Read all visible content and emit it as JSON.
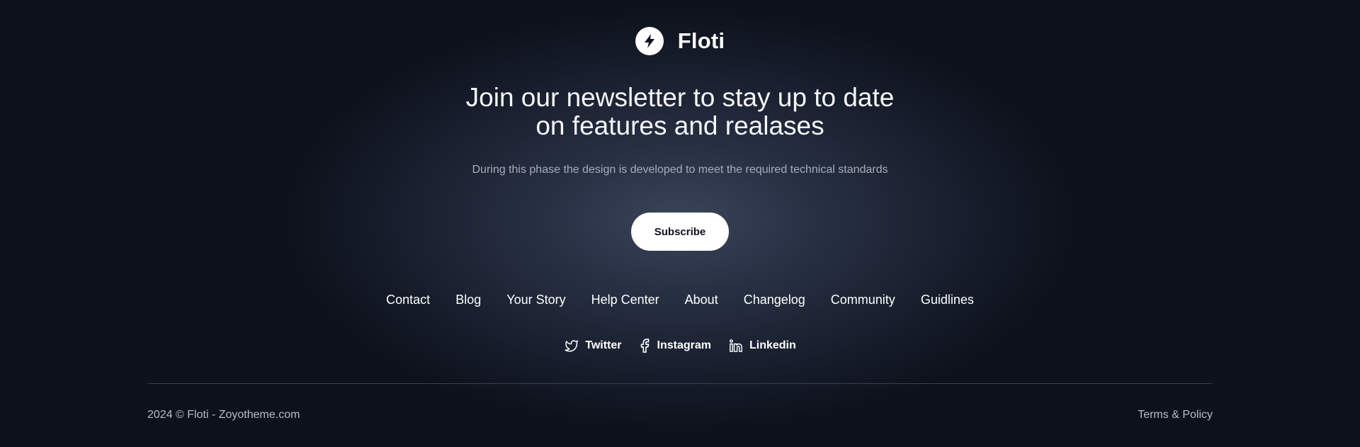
{
  "brand": {
    "name": "Floti",
    "logo_icon": "lightning-bolt-icon"
  },
  "newsletter": {
    "headline_line1": "Join our newsletter to stay up to date",
    "headline_line2": "on features and realases",
    "description": "During this phase the design is developed to meet the required technical standards",
    "subscribe_label": "Subscribe"
  },
  "nav": {
    "links": [
      {
        "label": "Contact"
      },
      {
        "label": "Blog"
      },
      {
        "label": "Your Story"
      },
      {
        "label": "Help Center"
      },
      {
        "label": "About"
      },
      {
        "label": "Changelog"
      },
      {
        "label": "Community"
      },
      {
        "label": "Guidlines"
      }
    ]
  },
  "social": {
    "links": [
      {
        "label": "Twitter",
        "icon": "twitter-icon"
      },
      {
        "label": "Instagram",
        "icon": "facebook-icon"
      },
      {
        "label": "Linkedin",
        "icon": "linkedin-icon"
      }
    ]
  },
  "bottom": {
    "copyright": "2024 © Floti - Zoyotheme.com",
    "terms": "Terms & Policy"
  },
  "colors": {
    "background": "#0d111b",
    "accent": "#ffffff",
    "muted_text": "#a7adba"
  }
}
